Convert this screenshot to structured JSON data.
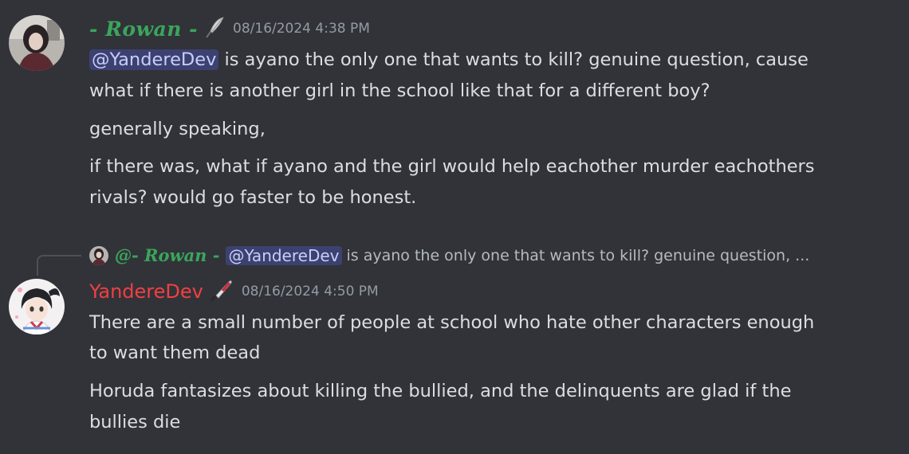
{
  "messages": [
    {
      "author": "- Rowan -",
      "timestamp": "08/16/2024 4:38 PM",
      "badge_icon": "quill-feather-icon",
      "lines": [
        {
          "mention": "@YandereDev",
          "text": " is ayano the only one that wants to kill? genuine question, cause"
        },
        {
          "text": "what if there is another girl in the school like that for a different boy?"
        },
        {
          "text": "generally speaking,"
        },
        {
          "text": "if there was, what if ayano and the girl would help eachother murder eachothers"
        },
        {
          "text": "rivals? would go faster to be honest."
        }
      ]
    },
    {
      "reply": {
        "author": "@- Rowan -",
        "mention": "@YandereDev",
        "snippet": "is ayano the only one that wants to kill? genuine question, ..."
      },
      "author": "YandereDev",
      "timestamp": "08/16/2024 4:50 PM",
      "badge_icon": "bloody-knife-icon",
      "lines": [
        {
          "text": "There are a small number of people at school who hate other characters enough"
        },
        {
          "text": "to want them dead"
        },
        {
          "text": "Horuda fantasizes about killing the bullied, and the delinquents are glad if the"
        },
        {
          "text": "bullies die"
        }
      ]
    }
  ],
  "colors": {
    "background": "#313338",
    "text": "#dbdee1",
    "muted": "#949ba4",
    "rowan_name": "#3ba55c",
    "yandere_name": "#f23f43",
    "mention_bg": "#3c4270",
    "mention_text": "#c9cdfb"
  }
}
